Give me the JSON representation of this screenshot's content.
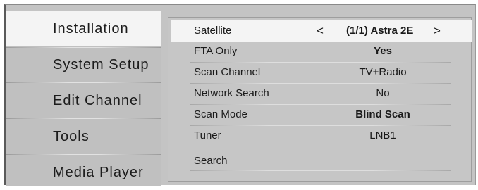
{
  "sidebar": {
    "items": [
      {
        "label": "Installation",
        "active": true
      },
      {
        "label": "System Setup"
      },
      {
        "label": "Edit Channel"
      },
      {
        "label": "Tools"
      },
      {
        "label": "Media Player"
      }
    ]
  },
  "installation": {
    "satellite": {
      "label": "Satellite",
      "value": "(1/1) Astra 2E",
      "prev": "<",
      "next": ">"
    },
    "fta_only": {
      "label": "FTA Only",
      "value": "Yes"
    },
    "scan_channel": {
      "label": "Scan Channel",
      "value": "TV+Radio"
    },
    "network_search": {
      "label": "Network Search",
      "value": "No"
    },
    "scan_mode": {
      "label": "Scan Mode",
      "value": "Blind Scan"
    },
    "tuner": {
      "label": "Tuner",
      "value": "LNB1"
    },
    "search": {
      "label": "Search"
    }
  },
  "colors": {
    "background": "#c4c4c4",
    "highlight": "#f4f4f4",
    "text": "#1a1a1a"
  }
}
